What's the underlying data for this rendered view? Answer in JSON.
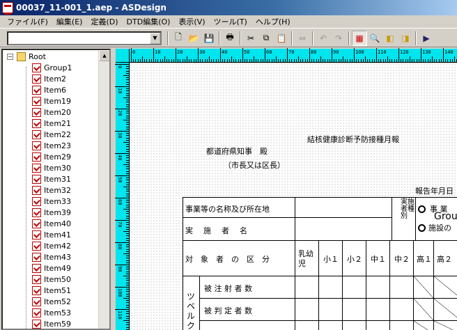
{
  "window": {
    "title": "00037_11-001_1.aep - ASDesign"
  },
  "menu": [
    "ファイル(F)",
    "編集(E)",
    "定義(D)",
    "DTD編集(O)",
    "表示(V)",
    "ツール(T)",
    "ヘルプ(H)"
  ],
  "toolbar": {
    "combo_value": ""
  },
  "tree": {
    "root": "Root",
    "items": [
      "Group1",
      "Item2",
      "Item6",
      "Item19",
      "Item20",
      "Item21",
      "Item22",
      "Item23",
      "Item29",
      "Item30",
      "Item31",
      "Item32",
      "Item33",
      "Item39",
      "Item40",
      "Item41",
      "Item42",
      "Item43",
      "Item49",
      "Item50",
      "Item51",
      "Item52",
      "Item53",
      "Item59"
    ]
  },
  "ruler": {
    "h_labels": [
      "0",
      "10",
      "20",
      "30",
      "40",
      "50",
      "60",
      "70",
      "80",
      "90",
      "100",
      "110",
      "120",
      "130",
      "140"
    ],
    "v_labels": [
      "0",
      "10",
      "20",
      "30",
      "40",
      "50",
      "60",
      "70",
      "80",
      "90",
      "100",
      "110"
    ]
  },
  "document": {
    "report_title": "結核健康診断予防接種月報",
    "addressee": "都道府県知事　殿",
    "addressee_note": "（市長又は区長）",
    "report_date": "報告年月日",
    "row_business": "事業等の名称及び所在地",
    "row_implementer": "実　施　者　名",
    "row_category": "対　象　者　の　区　分",
    "col_implementer_type": "実施者種別",
    "option_business": "事 業",
    "option_group": "Grou",
    "option_facility": "施設の",
    "columns": [
      "乳幼児",
      "小１",
      "小２",
      "中１",
      "中２",
      "高１",
      "高２"
    ],
    "side_label": "ツベルク",
    "row_injection": "被 注 射 者 数",
    "row_judged": "被 判 定 者 数"
  }
}
